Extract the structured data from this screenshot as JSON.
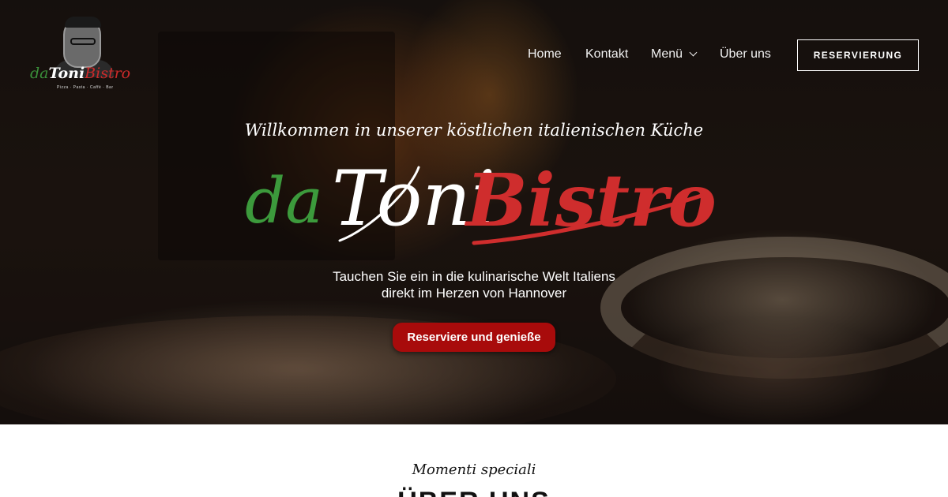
{
  "brand": {
    "logo_word_da": "da",
    "logo_word_toni": "Toni",
    "logo_word_bistro": "Bistro",
    "logo_tagline": "Pizza · Pasta · Caffè · Bar"
  },
  "nav": {
    "items": [
      {
        "label": "Home"
      },
      {
        "label": "Kontakt"
      },
      {
        "label": "Menü",
        "has_dropdown": true
      },
      {
        "label": "Über uns"
      }
    ],
    "reserve_label": "RESERVIERUNG"
  },
  "hero": {
    "welcome": "Willkommen in unserer köstlichen italienischen Küche",
    "title_da": "da",
    "title_toni": "Toni",
    "title_bistro": "Bistro",
    "tagline_line1": "Tauchen Sie ein in die kulinarische Welt Italiens",
    "tagline_line2": "direkt im Herzen von Hannover",
    "cta_label": "Reserviere und genieße"
  },
  "section": {
    "subtitle": "Momenti speciali",
    "title": "ÜBER UNS"
  },
  "colors": {
    "brand_green": "#3c9a3c",
    "brand_red": "#cf2d2d",
    "cta_bg": "#a80b0b"
  }
}
